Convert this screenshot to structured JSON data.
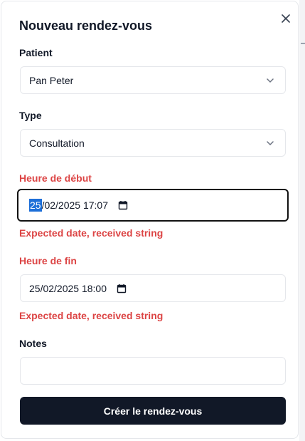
{
  "dialog": {
    "title": "Nouveau rendez-vous",
    "close_icon": "close-icon"
  },
  "patient": {
    "label": "Patient",
    "value": "Pan Peter"
  },
  "type": {
    "label": "Type",
    "value": "Consultation"
  },
  "start": {
    "label": "Heure de début",
    "day_selected": "25",
    "value_rest": "/02/2025 17:07",
    "error": "Expected date, received string"
  },
  "end": {
    "label": "Heure de fin",
    "value": "25/02/2025 18:00",
    "error": "Expected date, received string"
  },
  "notes": {
    "label": "Notes",
    "value": ""
  },
  "submit": {
    "label": "Créer le rendez-vous"
  },
  "colors": {
    "error": "#dc4444",
    "primary_button": "#111827",
    "selection": "#1d6fd8"
  }
}
